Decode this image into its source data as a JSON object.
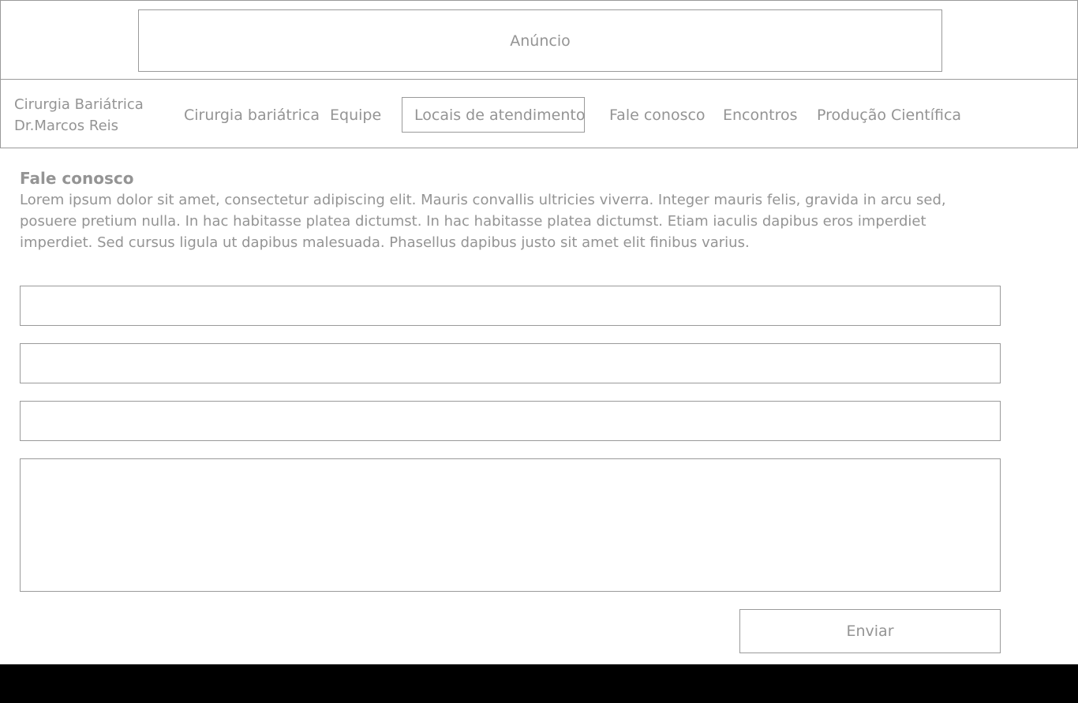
{
  "ad": {
    "label": "Anúncio"
  },
  "brand": {
    "line1": "Cirurgia Bariátrica",
    "line2": "Dr.Marcos Reis"
  },
  "nav": {
    "items": [
      {
        "label": "Cirurgia bariátrica"
      },
      {
        "label": "Equipe"
      },
      {
        "label": "Locais de atendimento",
        "active": true
      },
      {
        "label": "Fale conosco"
      },
      {
        "label": "Encontros"
      },
      {
        "label": "Produção Científica"
      }
    ]
  },
  "section": {
    "title": "Fale conosco",
    "text": "Lorem ipsum dolor sit amet, consectetur adipiscing elit. Mauris convallis ultricies viverra. Integer mauris felis, gravida in arcu sed, posuere pretium nulla. In hac habitasse platea dictumst. In hac habitasse platea dictumst. Etiam iaculis dapibus eros imperdiet imperdiet. Sed cursus ligula ut dapibus malesuada. Phasellus dapibus justo sit amet elit finibus varius."
  },
  "form": {
    "field1": "",
    "field2": "",
    "field3": "",
    "message": "",
    "submit_label": "Enviar"
  }
}
